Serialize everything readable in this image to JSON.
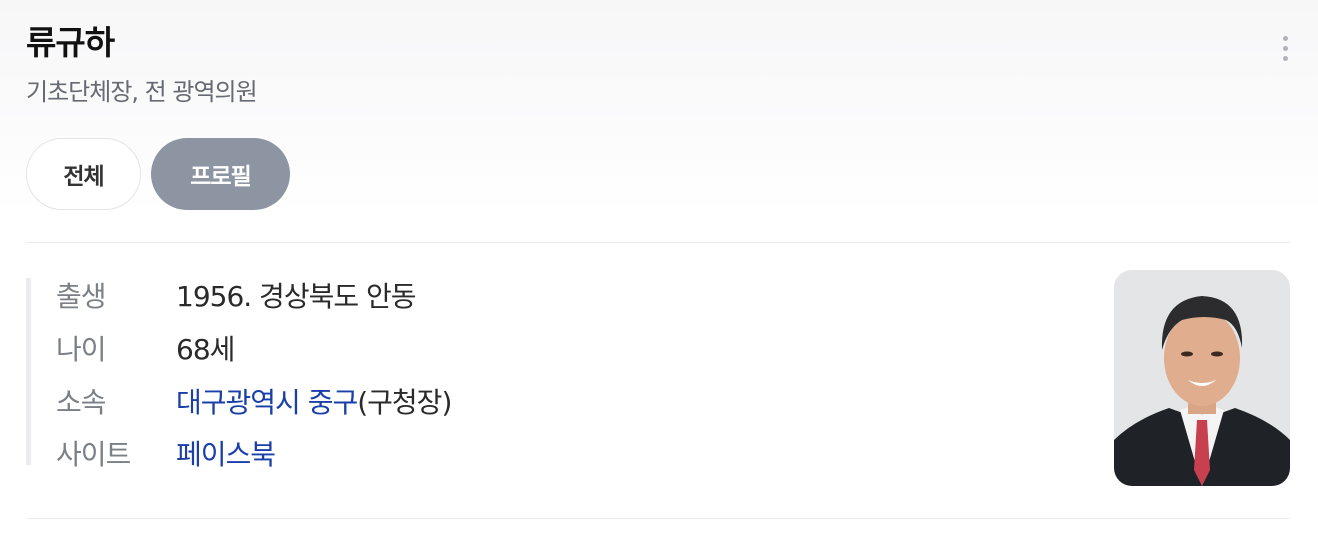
{
  "profile": {
    "name": "류규하",
    "subtitle": "기초단체장, 전 광역의원"
  },
  "menu": {
    "icon": "more-vertical-icon"
  },
  "tabs": [
    {
      "label": "전체",
      "active": false
    },
    {
      "label": "프로필",
      "active": true
    }
  ],
  "info": {
    "birth": {
      "label": "출생",
      "value": "1956. 경상북도 안동"
    },
    "age": {
      "label": "나이",
      "value": "68세"
    },
    "affiliation": {
      "label": "소속",
      "link": "대구광역시 중구",
      "suffix": "(구청장)"
    },
    "site": {
      "label": "사이트",
      "link": "페이스북"
    }
  },
  "colors": {
    "link": "#1a3fa8",
    "active_tab": "#8d95a3",
    "tie": "#c8404f"
  }
}
